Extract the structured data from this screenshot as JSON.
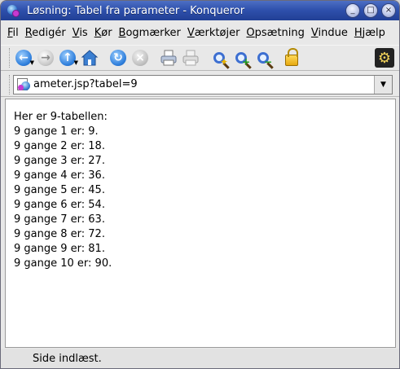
{
  "window": {
    "title": "Løsning: Tabel fra parameter - Konqueror",
    "buttons": {
      "minimize": "_",
      "maximize": "□",
      "close": "×"
    }
  },
  "menu": [
    {
      "label": "Fil",
      "u": "F",
      "rest": "il"
    },
    {
      "label": "Redigér",
      "u": "R",
      "rest": "edigér"
    },
    {
      "label": "Vis",
      "u": "V",
      "rest": "is"
    },
    {
      "label": "Kør",
      "u": "K",
      "rest": "ør"
    },
    {
      "label": "Bogmærker",
      "u": "B",
      "rest": "ogmærker"
    },
    {
      "label": "Værktøjer",
      "u": "V",
      "rest": "ærktøjer"
    },
    {
      "label": "Opsætning",
      "u": "O",
      "rest": "psætning"
    },
    {
      "label": "Vindue",
      "u": "V",
      "rest": "indue"
    },
    {
      "label": "Hjælp",
      "u": "H",
      "rest": "jælp"
    }
  ],
  "toolbar": {
    "icons": [
      "back-icon",
      "forward-icon",
      "up-icon",
      "home-icon",
      "reload-icon",
      "stop-icon",
      "print-icon",
      "print-frame-icon",
      "zoom-icon",
      "zoom-in-icon",
      "zoom-out-icon",
      "lock-icon"
    ]
  },
  "location": {
    "url": "ameter.jsp?tabel=9"
  },
  "content": {
    "heading": "Her er 9-tabellen:",
    "lines": [
      "9 gange 1 er: 9.",
      "9 gange 2 er: 18.",
      "9 gange 3 er: 27.",
      "9 gange 4 er: 36.",
      "9 gange 5 er: 45.",
      "9 gange 6 er: 54.",
      "9 gange 7 er: 63.",
      "9 gange 8 er: 72.",
      "9 gange 9 er: 81.",
      "9 gange 10 er: 90."
    ]
  },
  "status": {
    "text": "Side indlæst."
  },
  "colors": {
    "titlebar": "#2f51ad",
    "title_text": "#ffffff",
    "content_bg": "#ffffff"
  }
}
